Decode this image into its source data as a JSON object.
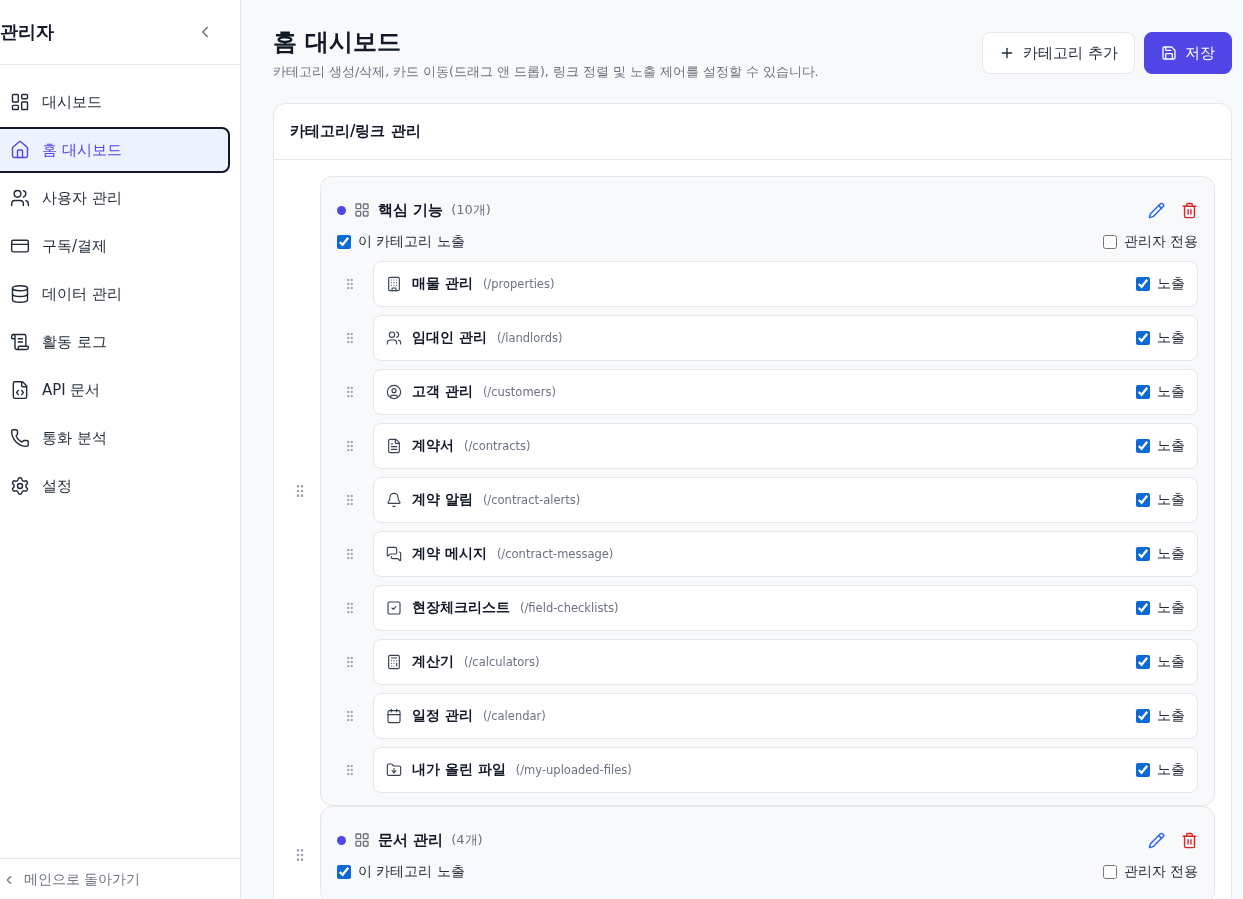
{
  "sidebar": {
    "title": "관리자",
    "items": [
      {
        "label": "대시보드",
        "selected": false
      },
      {
        "label": "홈 대시보드",
        "selected": true
      },
      {
        "label": "사용자 관리",
        "selected": false
      },
      {
        "label": "구독/결제",
        "selected": false
      },
      {
        "label": "데이터 관리",
        "selected": false
      },
      {
        "label": "활동 로그",
        "selected": false
      },
      {
        "label": "API 문서",
        "selected": false
      },
      {
        "label": "통화 분석",
        "selected": false
      },
      {
        "label": "설정",
        "selected": false
      }
    ],
    "back_link": "메인으로 돌아가기"
  },
  "page": {
    "title": "홈 대시보드",
    "subtitle": "카테고리 생성/삭제, 카드 이동(드래그 앤 드롭), 링크 정렬 및 노출 제어를 설정할 수 있습니다.",
    "buttons": [
      "카테고리 추가",
      "저장"
    ]
  },
  "panel": {
    "title": "카테고리/링크 관리",
    "categories": [
      {
        "name": "핵심 기능",
        "count": "(10개)",
        "color": "#4f46e5",
        "visible_label": "이 카테고리 노출",
        "visible": true,
        "admin_label": "관리자 전용",
        "admin_only": false,
        "links": [
          {
            "name": "매물 관리",
            "path": "(/properties)",
            "visible_label": "노출",
            "visible": true
          },
          {
            "name": "임대인 관리",
            "path": "(/landlords)",
            "visible_label": "노출",
            "visible": true
          },
          {
            "name": "고객 관리",
            "path": "(/customers)",
            "visible_label": "노출",
            "visible": true
          },
          {
            "name": "계약서",
            "path": "(/contracts)",
            "visible_label": "노출",
            "visible": true
          },
          {
            "name": "계약 알림",
            "path": "(/contract-alerts)",
            "visible_label": "노출",
            "visible": true
          },
          {
            "name": "계약 메시지",
            "path": "(/contract-message)",
            "visible_label": "노출",
            "visible": true
          },
          {
            "name": "현장체크리스트",
            "path": "(/field-checklists)",
            "visible_label": "노출",
            "visible": true
          },
          {
            "name": "계산기",
            "path": "(/calculators)",
            "visible_label": "노출",
            "visible": true
          },
          {
            "name": "일정 관리",
            "path": "(/calendar)",
            "visible_label": "노출",
            "visible": true
          },
          {
            "name": "내가 올린 파일",
            "path": "(/my-uploaded-files)",
            "visible_label": "노출",
            "visible": true
          }
        ]
      },
      {
        "name": "문서 관리",
        "count": "(4개)",
        "color": "#4f46e5",
        "visible_label": "이 카테고리 노출",
        "visible": true,
        "admin_label": "관리자 전용",
        "admin_only": false
      }
    ]
  }
}
